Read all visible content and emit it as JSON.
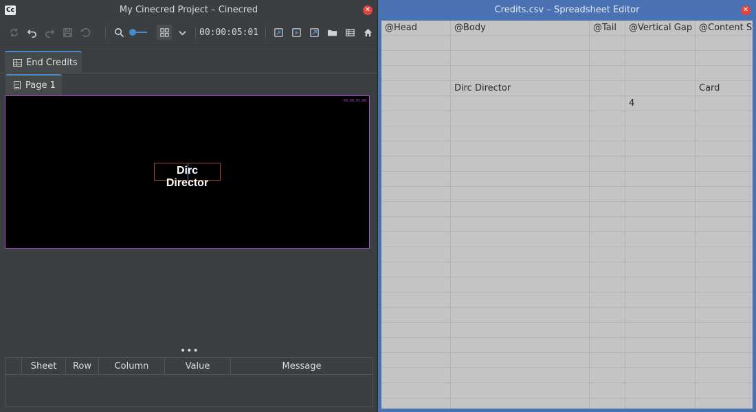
{
  "cinecred": {
    "app_logo": "Cc",
    "title": "My Cinecred Project – Cinecred",
    "toolbar": {
      "timecode": "00:00:05:01",
      "icons": [
        "reset-icon",
        "undo-icon",
        "redo-icon",
        "save-icon",
        "revert-icon",
        "zoom-icon",
        "layout-toggle-icon",
        "chevron-down-icon",
        "export-icon",
        "play-icon",
        "open-external-icon",
        "folder-icon",
        "table-icon",
        "home-icon"
      ]
    },
    "tabs": {
      "spreadsheet_tab": "End Credits",
      "page_tab": "Page 1"
    },
    "preview": {
      "timecode": "00:00:05:00",
      "credit_text": "Dirc Director"
    },
    "more_dots": "•••",
    "log_table": {
      "columns": [
        "",
        "Sheet",
        "Row",
        "Column",
        "Value",
        "Message"
      ]
    }
  },
  "spreadsheet": {
    "title": "Credits.csv – Spreadsheet Editor",
    "columns": [
      "@Head",
      "@Body",
      "@Tail",
      "@Vertical Gap",
      "@Content Sty"
    ],
    "rows": [
      [
        "",
        "",
        "",
        "",
        ""
      ],
      [
        "",
        "",
        "",
        "",
        ""
      ],
      [
        "",
        "",
        "",
        "",
        ""
      ],
      [
        "",
        "Dirc Director",
        "",
        "",
        "Card"
      ],
      [
        "",
        "",
        "",
        "4",
        ""
      ],
      [
        "",
        "",
        "",
        "",
        ""
      ],
      [
        "",
        "",
        "",
        "",
        ""
      ],
      [
        "",
        "",
        "",
        "",
        ""
      ],
      [
        "",
        "",
        "",
        "",
        ""
      ],
      [
        "",
        "",
        "",
        "",
        ""
      ],
      [
        "",
        "",
        "",
        "",
        ""
      ],
      [
        "",
        "",
        "",
        "",
        ""
      ],
      [
        "",
        "",
        "",
        "",
        ""
      ],
      [
        "",
        "",
        "",
        "",
        ""
      ],
      [
        "",
        "",
        "",
        "",
        ""
      ],
      [
        "",
        "",
        "",
        "",
        ""
      ],
      [
        "",
        "",
        "",
        "",
        ""
      ],
      [
        "",
        "",
        "",
        "",
        ""
      ],
      [
        "",
        "",
        "",
        "",
        ""
      ],
      [
        "",
        "",
        "",
        "",
        ""
      ],
      [
        "",
        "",
        "",
        "",
        ""
      ],
      [
        "",
        "",
        "",
        "",
        ""
      ],
      [
        "",
        "",
        "",
        "",
        ""
      ],
      [
        "",
        "",
        "",
        "",
        ""
      ],
      [
        "",
        "",
        "",
        "",
        ""
      ]
    ]
  },
  "colors": {
    "accent": "#4a88c7",
    "preview_border": "#b04ad0",
    "close": "#e0443e",
    "sheet_frame": "#4a71b2"
  }
}
